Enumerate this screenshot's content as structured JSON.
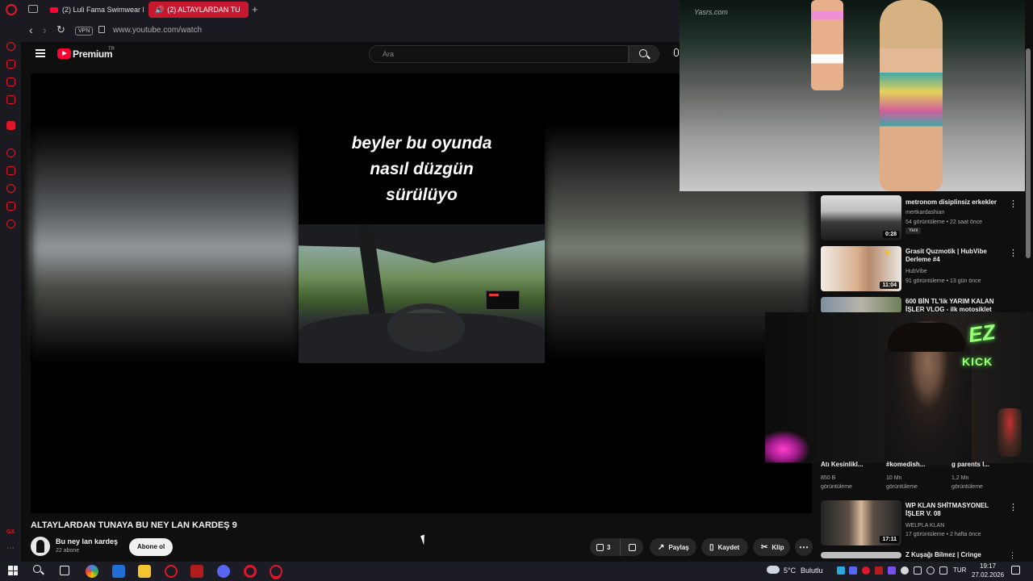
{
  "browser": {
    "tabs": [
      {
        "label": "(2) Luli Fama Swimwear F"
      },
      {
        "label": "(2) ALTAYLARDAN TU"
      }
    ],
    "new_tab": "+",
    "vpn_label": "VPN",
    "url": "www.youtube.com/watch",
    "sidebar_badge": "GX"
  },
  "youtube": {
    "brand": "Premium",
    "region": "TR",
    "search_placeholder": "Ara"
  },
  "video": {
    "caption_lines": [
      "beyler bu oyunda",
      "nasıl düzgün",
      "sürülüyo"
    ],
    "title": "ALTAYLARDAN TUNAYA BU NEY LAN KARDEŞ 9",
    "channel_name": "Bu ney lan kardeş",
    "channel_subs": "22 abone",
    "subscribe_label": "Abone ol",
    "likes": "3",
    "share_label": "Paylaş",
    "save_label": "Kaydet",
    "clip_label": "Klip",
    "more_label": "⋯"
  },
  "pip": {
    "watermark": "Yasrs.com"
  },
  "recommendations": [
    {
      "title": "metronom disiplinsiz erkekler",
      "channel": "mertkardashian",
      "meta": "54 görüntüleme • 22 saat önce",
      "duration": "0:28",
      "badge": "Yeni"
    },
    {
      "title": "Grasit Quzmotik | HubVibe Derleme #4",
      "channel": "HubVibe",
      "meta": "91 görüntüleme • 13 gün önce",
      "duration": "11:04"
    },
    {
      "title": "600 BİN TL'lik YARIM KALAN İŞLER VLOG - ilk motosiklet",
      "channel": "",
      "meta": "",
      "duration": ""
    },
    {
      "title": "WP KLAN SHİTMASYONEL İŞLER V. 08",
      "channel": "WELPLA KLAN",
      "meta": "17 görüntüleme • 2 hafta önce",
      "duration": "17:11"
    },
    {
      "title": "Z Kuşağı Bilmez | Cringe Damarı",
      "channel": "",
      "meta": "",
      "duration": ""
    }
  ],
  "shorts": [
    {
      "title": "Atı Kesinlikl...",
      "views": "850 B",
      "views_label": "görüntüleme"
    },
    {
      "title": "#komedish...",
      "views": "10 Mn",
      "views_label": "görüntüleme"
    },
    {
      "title": "g parents l...",
      "views": "1,2 Mn",
      "views_label": "görüntüleme"
    }
  ],
  "stream_overlay": {
    "logo_top": "EZ",
    "logo_bottom": "KICK"
  },
  "taskbar": {
    "weather_temp": "5°C",
    "weather_desc": "Bulutlu",
    "language": "TUR",
    "time": "19:17",
    "date": "27.02.2026"
  },
  "icons": [
    "search-icon",
    "mic-icon",
    "menu-icon",
    "like-icon",
    "dislike-icon",
    "share-icon",
    "save-icon",
    "clip-icon",
    "more-icon"
  ]
}
